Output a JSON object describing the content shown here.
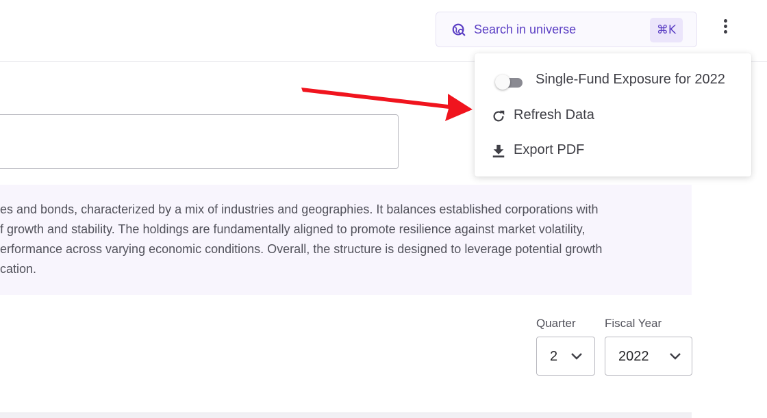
{
  "header": {
    "search_label": "Search in universe",
    "search_shortcut": "⌘K",
    "search_icon": "search-globe-icon",
    "more_icon": "more-vertical-icon"
  },
  "summary": {
    "lines": [
      "es and bonds, characterized by a mix of industries and geographies. It balances established corporations with",
      "f growth and stability. The holdings are fundamentally aligned to promote resilience against market volatility,",
      "erformance across varying economic conditions. Overall, the structure is designed to leverage potential growth",
      "cation."
    ]
  },
  "filters": {
    "quarter": {
      "label": "Quarter",
      "value": "2"
    },
    "fiscal_year": {
      "label": "Fiscal Year",
      "value": "2022"
    }
  },
  "menu": {
    "items": [
      {
        "label": "Single-Fund Exposure for 2022",
        "icon": "toggle-switch",
        "toggle_on": false
      },
      {
        "label": "Refresh Data",
        "icon": "refresh-icon"
      },
      {
        "label": "Export PDF",
        "icon": "download-icon"
      }
    ]
  },
  "colors": {
    "accent": "#5b3fc4",
    "summary_bg": "#f8f5fd",
    "annotation_arrow": "#f0141e"
  }
}
